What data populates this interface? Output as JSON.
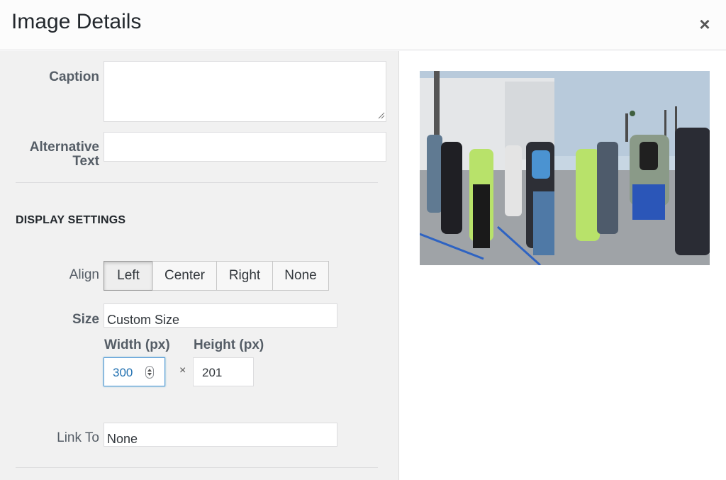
{
  "header": {
    "title": "Image Details",
    "close_icon": "close-icon"
  },
  "fields": {
    "caption": {
      "label": "Caption",
      "value": ""
    },
    "alt_text": {
      "label_line1": "Alternative",
      "label_line2": "Text",
      "value": ""
    }
  },
  "display_settings": {
    "heading": "DISPLAY SETTINGS",
    "align": {
      "label": "Align",
      "options": [
        "Left",
        "Center",
        "Right",
        "None"
      ],
      "selected": "Left"
    },
    "size": {
      "label": "Size",
      "value": "Custom Size"
    },
    "width": {
      "label": "Width (px)",
      "value": "300"
    },
    "height": {
      "label": "Height (px)",
      "value": "201"
    },
    "times": "×",
    "link_to": {
      "label": "Link To",
      "value": "None"
    }
  },
  "preview": {
    "description_icon": "photo-preview"
  },
  "colors": {
    "focus_border": "#5b9dd9",
    "panel_bg": "#f1f1f1",
    "text": "#23282d"
  }
}
